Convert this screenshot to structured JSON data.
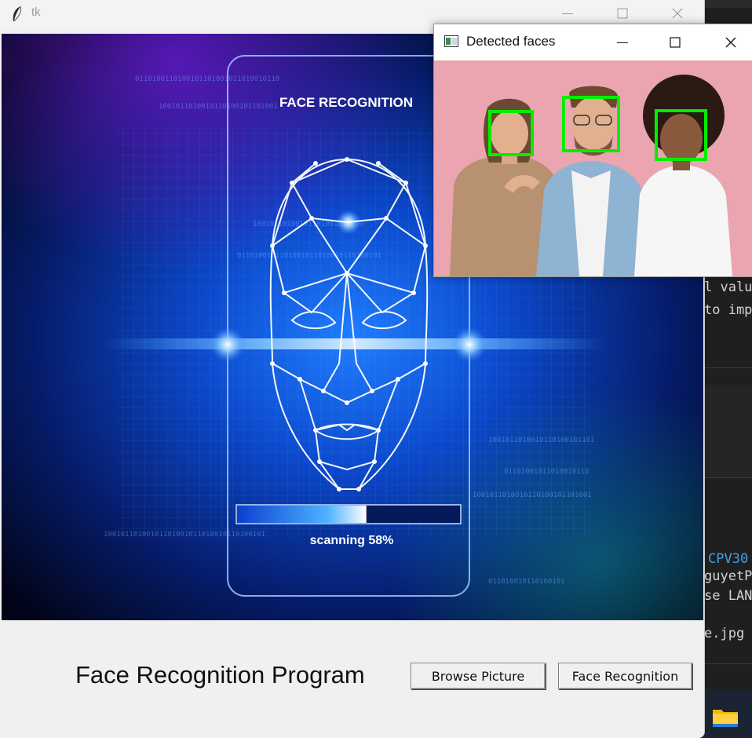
{
  "main_window": {
    "title": "tk",
    "hero": {
      "card_title": "FACE RECOGNITION",
      "scan_label": "scanning 58%",
      "scan_progress": 0.58
    },
    "program_title": "Face Recognition Program",
    "buttons": {
      "browse": "Browse Picture",
      "recognize": "Face Recognition"
    }
  },
  "faces_window": {
    "title": "Detected faces",
    "detected_count": 3,
    "box_color": "#00ee00"
  },
  "background_editor": {
    "line1": "l valu",
    "line2": "to imp",
    "line3": "CPV30",
    "line4": "guyetP",
    "line5": "se LAN",
    "line6": "e.jpg"
  },
  "colors": {
    "scan_blue": "#1a6cff",
    "hero_glow": "#2f8bff"
  }
}
